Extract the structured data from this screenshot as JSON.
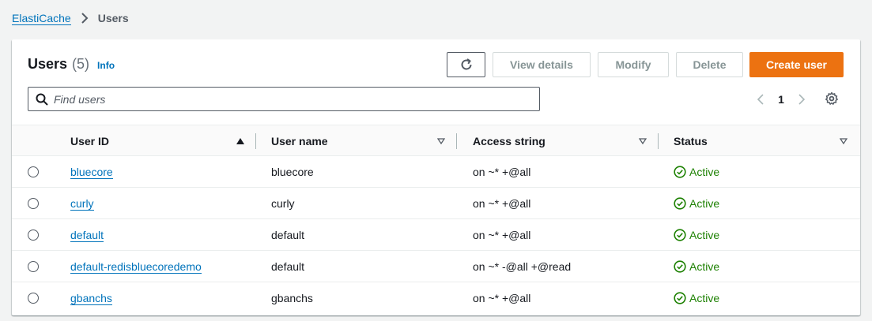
{
  "breadcrumb": {
    "root": "ElastiCache",
    "current": "Users"
  },
  "header": {
    "title": "Users",
    "count": "(5)",
    "info": "Info"
  },
  "toolbar": {
    "refresh_icon": "refresh-icon",
    "view_details": "View details",
    "modify": "Modify",
    "delete": "Delete",
    "create_user": "Create user"
  },
  "search": {
    "placeholder": "Find users",
    "value": ""
  },
  "pagination": {
    "current_page": "1"
  },
  "table": {
    "columns": [
      "User ID",
      "User name",
      "Access string",
      "Status"
    ],
    "sorted_column": "User ID",
    "rows": [
      {
        "user_id": "bluecore",
        "user_name": "bluecore",
        "access_string": "on ~* +@all",
        "status": "Active"
      },
      {
        "user_id": "curly",
        "user_name": "curly",
        "access_string": "on ~* +@all",
        "status": "Active"
      },
      {
        "user_id": "default",
        "user_name": "default",
        "access_string": "on ~* +@all",
        "status": "Active"
      },
      {
        "user_id": "default-redisbluecoredemo",
        "user_name": "default",
        "access_string": "on ~* -@all +@read",
        "status": "Active"
      },
      {
        "user_id": "gbanchs",
        "user_name": "gbanchs",
        "access_string": "on ~* +@all",
        "status": "Active"
      }
    ]
  },
  "colors": {
    "link": "#0073bb",
    "primary_button": "#ec7211",
    "status_success": "#1d8102",
    "background": "#f2f3f3"
  }
}
